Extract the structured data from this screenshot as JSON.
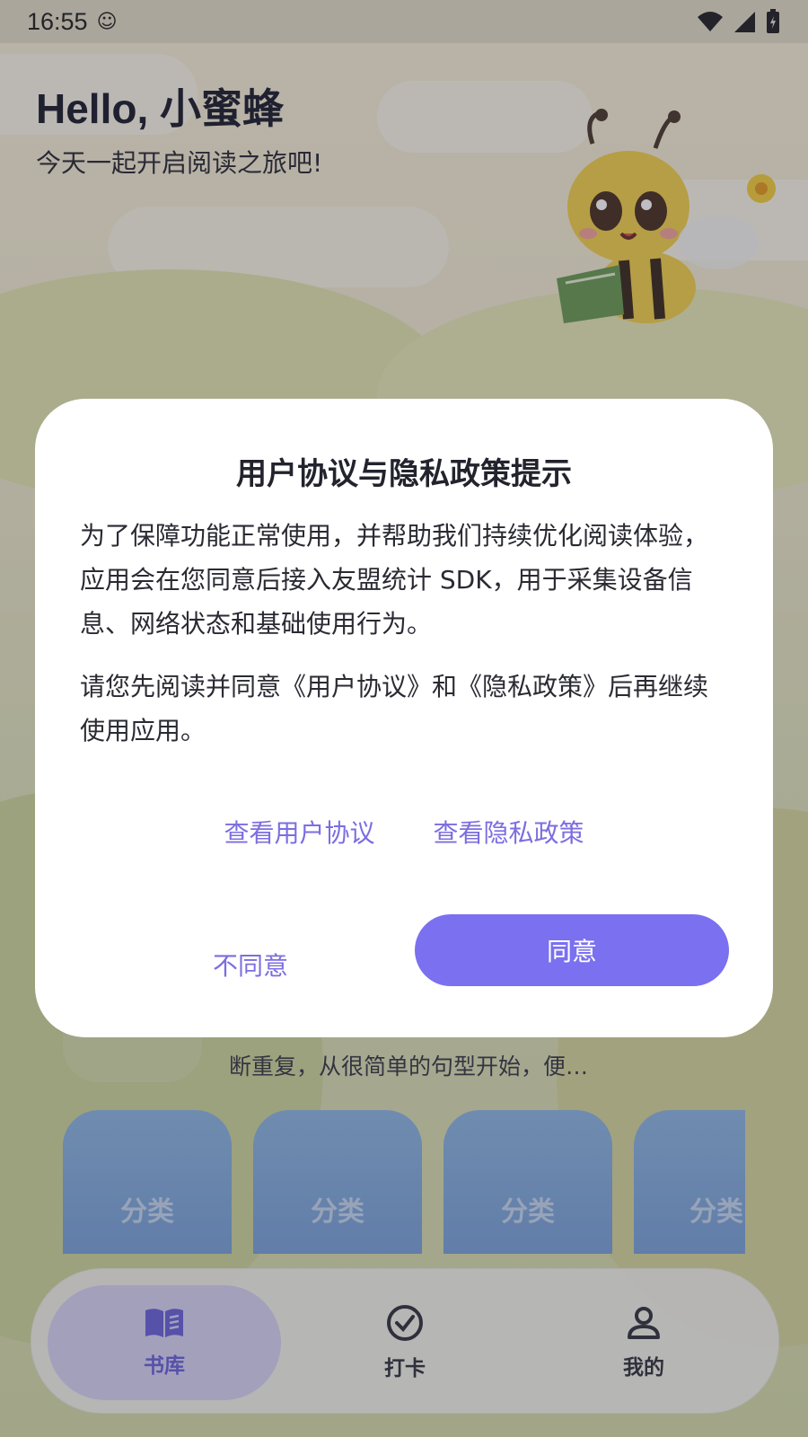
{
  "status_bar": {
    "time": "16:55"
  },
  "header": {
    "greeting": "Hello, 小蜜蜂",
    "subtitle": "今天一起开启阅读之旅吧!"
  },
  "story": {
    "snippet": "断重复，从很简单的句型开始，便…"
  },
  "categories": [
    "分类",
    "分类",
    "分类",
    "分类"
  ],
  "nav": {
    "items": [
      {
        "label": "书库",
        "icon": "book-icon",
        "active": true
      },
      {
        "label": "打卡",
        "icon": "check-circle-icon",
        "active": false
      },
      {
        "label": "我的",
        "icon": "person-icon",
        "active": false
      }
    ]
  },
  "dialog": {
    "title": "用户协议与隐私政策提示",
    "paragraph1": "为了保障功能正常使用，并帮助我们持续优化阅读体验，应用会在您同意后接入友盟统计 SDK，用于采集设备信息、网络状态和基础使用行为。",
    "paragraph2": "请您先阅读并同意《用户协议》和《隐私政策》后再继续使用应用。",
    "link_user_agreement": "查看用户协议",
    "link_privacy_policy": "查看隐私政策",
    "disagree_label": "不同意",
    "agree_label": "同意"
  },
  "colors": {
    "accent": "#7a70f0",
    "link": "#7b6ee0"
  }
}
